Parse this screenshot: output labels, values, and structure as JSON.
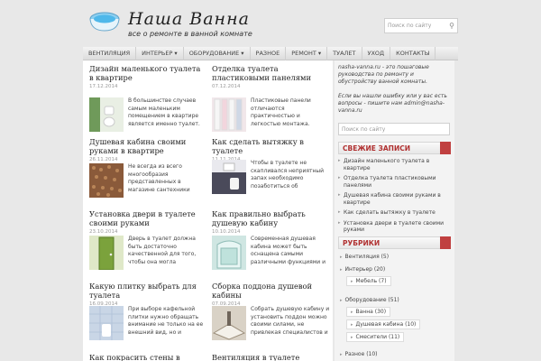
{
  "site": {
    "title": "Наша Ванна",
    "subtitle": "все о ремонте в ванной комнате"
  },
  "search": {
    "placeholder": "Поиск по сайту"
  },
  "nav": [
    "Вентиляция",
    "Интерьер ▾",
    "Оборудование ▾",
    "Разное",
    "Ремонт ▾",
    "Туалет",
    "Уход",
    "Контакты"
  ],
  "posts": [
    {
      "title": "Дизайн маленького туалета в квартире",
      "date": "17.12.2014",
      "excerpt": "В большинстве случаев самым маленьким помещением в квартире является именно туалет. Чтобы сделать его уютным"
    },
    {
      "title": "Отделка туалета пластиковыми панелями",
      "date": "07.12.2014",
      "excerpt": "Пластиковые панели отличаются практичностью и легкостью монтажа. Данный отделочный материал лучше всего"
    },
    {
      "title": "Душевая кабина своими руками в квартире",
      "date": "26.11.2014",
      "excerpt": "Не всегда из всего многообразия представленных в магазине сантехники душевых кабин можно выбрать ту, которая"
    },
    {
      "title": "Как сделать вытяжку в туалете",
      "date": "11.11.2014",
      "excerpt": "Чтобы в туалете не скапливался неприятный запах необходимо позаботиться об устройстве вентиляции в данном помещении."
    },
    {
      "title": "Установка двери в туалете своими руками",
      "date": "23.10.2014",
      "excerpt": "Дверь в туалет должна быть достаточно качественной для того, чтобы она могла справляться с повышенной"
    },
    {
      "title": "Как правильно выбрать душевую кабину",
      "date": "10.10.2014",
      "excerpt": "Современная душевая кабина может быть оснащена самыми различными функциями и сделана из разных видов"
    },
    {
      "title": "Какую плитку выбрать для туалета",
      "date": "16.09.2014",
      "excerpt": "При выборе кафельной плитки нужно обращать внимание не только на ее внешний вид, но и"
    },
    {
      "title": "Сборка поддона душевой кабины",
      "date": "07.09.2014",
      "excerpt": "Собрать душевую кабину и установить поддон можно своими силами, не привлекая специалистов и не затрачивая"
    },
    {
      "title": "Как покрасить стены в туалете",
      "date": "",
      "excerpt": ""
    },
    {
      "title": "Вентиляция в туалете частного",
      "date": "",
      "excerpt": ""
    }
  ],
  "sidebar": {
    "intro": "nasha-vanna.ru - это пошаговые руководства по ремонту и обустройству ванной комнаты.",
    "contact": "Если вы нашли ошибку или у вас есть вопросы - пишите нам admin@nasha-vanna.ru",
    "search_placeholder": "Поиск по сайту",
    "recent_title": "Свежие записи",
    "recent": [
      "Дизайн маленького туалета в квартире",
      "Отделка туалета пластиковыми панелями",
      "Душевая кабина своими руками в квартире",
      "Как сделать вытяжку в туалете",
      "Установка двери в туалете своими руками"
    ],
    "categories_title": "Рубрики",
    "categories": [
      "Вентиляция (5)",
      "Интерьер (20)",
      "Мебель (7)",
      "Оборудование (51)",
      "Ванна (30)",
      "Душевая кабина (10)",
      "Смесители (11)",
      "Разное (10)"
    ]
  },
  "colors": {
    "accent": "#b03030",
    "background": "#e8e8e8"
  }
}
